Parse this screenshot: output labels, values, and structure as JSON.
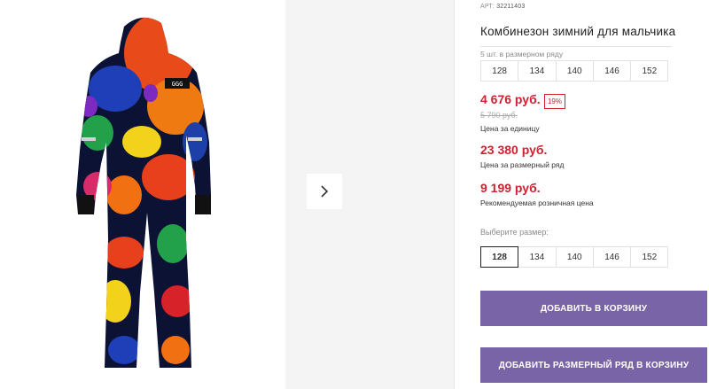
{
  "product": {
    "sku_label": "АРТ:",
    "sku": "32211403",
    "title": "Комбинезон зимний для мальчика"
  },
  "series": {
    "label": "5 шт. в размерном ряду",
    "sizes": [
      "128",
      "134",
      "140",
      "146",
      "152"
    ]
  },
  "pricing": {
    "unit_price": "4 676 руб.",
    "discount": "19%",
    "old_price": "5 790 руб.",
    "unit_caption": "Цена за единицу",
    "series_price": "23 380 руб.",
    "series_caption": "Цена за размерный ряд",
    "retail_price": "9 199 руб.",
    "retail_caption": "Рекомендуемая розничная цена"
  },
  "size_picker": {
    "label": "Выберите размер:",
    "sizes": [
      "128",
      "134",
      "140",
      "146",
      "152"
    ],
    "selected": "128"
  },
  "actions": {
    "add_to_cart": "ДОБАВИТЬ В КОРЗИНУ",
    "add_series_to_cart": "ДОБАВИТЬ РАЗМЕРНЫЙ РЯД В КОРЗИНУ"
  },
  "colors": {
    "accent": "#7a64a8",
    "price": "#d1202f"
  },
  "icons": {
    "next": "chevron-right-icon"
  },
  "patch_text": "GGG"
}
